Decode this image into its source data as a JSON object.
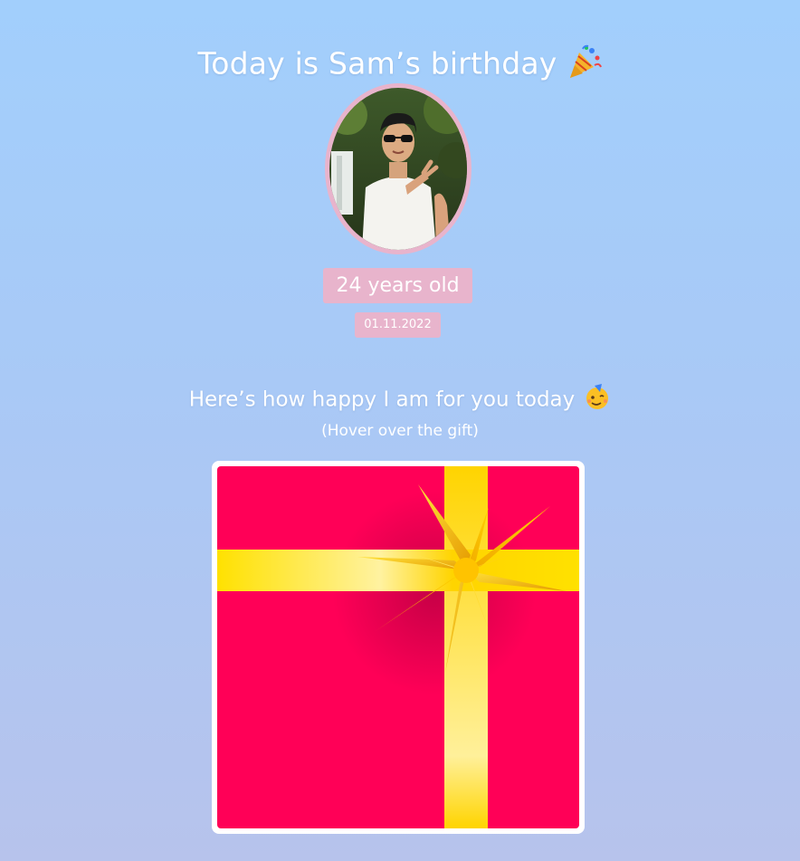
{
  "header": {
    "title": "Today is Sam’s birthday",
    "title_emoji_icon": "party-popper-icon"
  },
  "profile": {
    "photo": "photo of Sam",
    "age_label": "24 years old",
    "date_label": "01.11.2022"
  },
  "gift_section": {
    "heading": "Here’s how happy I am for you today",
    "heading_emoji_icon": "partying-face-icon",
    "hint": "(Hover over the gift)"
  },
  "colors": {
    "background_top": "#a2cffc",
    "background_bottom": "#b7c3ec",
    "badge": "#e8b4cc",
    "gift_box": "#ff0057",
    "ribbon": "#ffd400"
  }
}
